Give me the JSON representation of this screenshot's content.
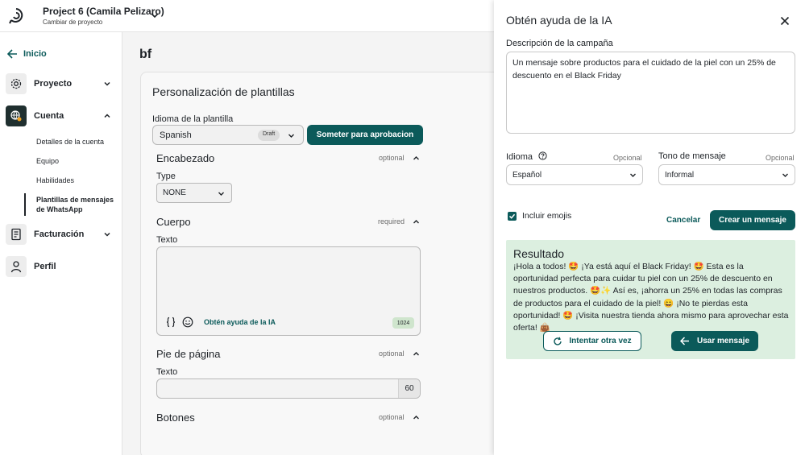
{
  "header": {
    "project_name": "Project 6 (Camila Pelizaro)",
    "project_sub": "Cambiar de proyecto"
  },
  "sidebar": {
    "back_label": "Inicio",
    "items": [
      {
        "label": "Proyecto",
        "icon": "gear-icon"
      },
      {
        "label": "Cuenta",
        "icon": "globe-icon"
      },
      {
        "label": "Facturación",
        "icon": "receipt-icon"
      },
      {
        "label": "Perfil",
        "icon": "user-icon"
      }
    ],
    "sub_items": [
      "Detalles de la cuenta",
      "Equipo",
      "Habilidades",
      "Plantillas de mensajes de WhatsApp"
    ]
  },
  "main": {
    "page_title": "bf",
    "card_title": "Personalización de plantillas",
    "language_label": "Idioma de la plantilla",
    "language_value": "Spanish",
    "draft_badge": "Draft",
    "submit_label": "Someter para aprobacion",
    "header_section": {
      "title": "Encabezado",
      "hint": "optional",
      "type_label": "Type",
      "type_value": "NONE"
    },
    "body_section": {
      "title": "Cuerpo",
      "hint": "required",
      "text_label": "Texto",
      "ai_link": "Obtén ayuda de la IA",
      "count": "1024"
    },
    "footer_section": {
      "title": "Pie de página",
      "hint": "optional",
      "text_label": "Texto",
      "count": "60"
    },
    "buttons_section": {
      "title": "Botones",
      "hint": "optional"
    }
  },
  "panel": {
    "title": "Obtén ayuda de la IA",
    "desc_label": "Descripción de la campaña",
    "desc_value": "Un mensaje sobre productos para el cuidado de la piel con un 25% de descuento en el Black Friday",
    "language_label": "Idioma",
    "language_optional": "Opcional",
    "language_value": "Español",
    "tone_label": "Tono de mensaje",
    "tone_optional": "Opcional",
    "tone_value": "Informal",
    "emoji_label": "Incluir emojis",
    "cancel_label": "Cancelar",
    "create_label": "Crear un mensaje",
    "result_title": "Resultado",
    "result_text": "¡Hola a todos! 🤩 ¡Ya está aquí el Black Friday! 🤩 Esta es la oportunidad perfecta para cuidar tu piel con un 25% de descuento en nuestros productos. 🤩✨ Así es, ¡ahorra un 25% en todas las compras de productos para el cuidado de la piel! 😄 ¡No te pierdas esta oportunidad! 🤩 ¡Visita nuestra tienda ahora mismo para aprovechar esta oferta! 👜",
    "retry_label": "Intentar otra vez",
    "use_label": "Usar mensaje"
  },
  "colors": {
    "accent": "#0b5a5a",
    "result_bg": "#dcefe0",
    "main_bg": "#f4f4f4"
  }
}
